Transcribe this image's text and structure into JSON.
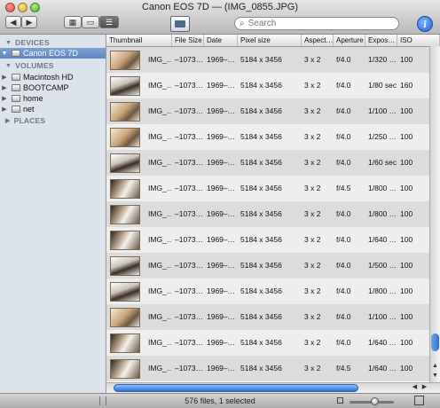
{
  "window": {
    "title": "Canon EOS 7D — (IMG_0855.JPG)"
  },
  "toolbar": {
    "back_glyph": "◀",
    "forward_glyph": "▶",
    "view_grid_glyph": "▦",
    "view_coverflow_glyph": "▭",
    "view_list_glyph": "☰",
    "search": {
      "placeholder": "Search",
      "value": ""
    },
    "info_glyph": "i"
  },
  "sidebar": {
    "devices_label": "DEVICES",
    "device_item": "Canon EOS 7D",
    "volumes_label": "VOLUMES",
    "volumes": [
      "Macintosh HD",
      "BOOTCAMP",
      "home",
      "net"
    ],
    "places_label": "PLACES"
  },
  "table": {
    "columns": [
      "Thumbnail",
      "File Size",
      "Date",
      "Pixel size",
      "Aspect…",
      "Aperture",
      "Expos…",
      "ISO"
    ],
    "rows": [
      {
        "name": "IMG_…",
        "size": "–1073…",
        "date": "1969–…",
        "pixels": "5184 x 3456",
        "aspect": "3 x 2",
        "aperture": "f/4.0",
        "exposure": "1/320 …",
        "iso": "100",
        "thumb": "a"
      },
      {
        "name": "IMG_…",
        "size": "–1073…",
        "date": "1969–…",
        "pixels": "5184 x 3456",
        "aspect": "3 x 2",
        "aperture": "f/4.0",
        "exposure": "1/80 sec",
        "iso": "160",
        "thumb": "b"
      },
      {
        "name": "IMG_…",
        "size": "–1073…",
        "date": "1969–…",
        "pixels": "5184 x 3456",
        "aspect": "3 x 2",
        "aperture": "f/4.0",
        "exposure": "1/100 …",
        "iso": "100",
        "thumb": "a"
      },
      {
        "name": "IMG_…",
        "size": "–1073…",
        "date": "1969–…",
        "pixels": "5184 x 3456",
        "aspect": "3 x 2",
        "aperture": "f/4.0",
        "exposure": "1/250 …",
        "iso": "100",
        "thumb": "a"
      },
      {
        "name": "IMG_…",
        "size": "–1073…",
        "date": "1969–…",
        "pixels": "5184 x 3456",
        "aspect": "3 x 2",
        "aperture": "f/4.0",
        "exposure": "1/60 sec",
        "iso": "100",
        "thumb": "b"
      },
      {
        "name": "IMG_…",
        "size": "–1073…",
        "date": "1969–…",
        "pixels": "5184 x 3456",
        "aspect": "3 x 2",
        "aperture": "f/4.5",
        "exposure": "1/800 …",
        "iso": "100",
        "thumb": "c"
      },
      {
        "name": "IMG_…",
        "size": "–1073…",
        "date": "1969–…",
        "pixels": "5184 x 3456",
        "aspect": "3 x 2",
        "aperture": "f/4.0",
        "exposure": "1/800 …",
        "iso": "100",
        "thumb": "c"
      },
      {
        "name": "IMG_…",
        "size": "–1073…",
        "date": "1969–…",
        "pixels": "5184 x 3456",
        "aspect": "3 x 2",
        "aperture": "f/4.0",
        "exposure": "1/640 …",
        "iso": "100",
        "thumb": "c"
      },
      {
        "name": "IMG_…",
        "size": "–1073…",
        "date": "1969–…",
        "pixels": "5184 x 3456",
        "aspect": "3 x 2",
        "aperture": "f/4.0",
        "exposure": "1/500 …",
        "iso": "100",
        "thumb": "b"
      },
      {
        "name": "IMG_…",
        "size": "–1073…",
        "date": "1969–…",
        "pixels": "5184 x 3456",
        "aspect": "3 x 2",
        "aperture": "f/4.0",
        "exposure": "1/800 …",
        "iso": "100",
        "thumb": "b"
      },
      {
        "name": "IMG_…",
        "size": "–1073…",
        "date": "1969–…",
        "pixels": "5184 x 3456",
        "aspect": "3 x 2",
        "aperture": "f/4.0",
        "exposure": "1/100 …",
        "iso": "100",
        "thumb": "a"
      },
      {
        "name": "IMG_…",
        "size": "–1073…",
        "date": "1969–…",
        "pixels": "5184 x 3456",
        "aspect": "3 x 2",
        "aperture": "f/4.0",
        "exposure": "1/640 …",
        "iso": "100",
        "thumb": "c"
      },
      {
        "name": "IMG_…",
        "size": "–1073…",
        "date": "1969–…",
        "pixels": "5184 x 3456",
        "aspect": "3 x 2",
        "aperture": "f/4.5",
        "exposure": "1/640 …",
        "iso": "100",
        "thumb": "c"
      }
    ]
  },
  "status": {
    "text": "576 files, 1 selected"
  },
  "colors": {
    "selection": "#6f93cc",
    "accent": "#2e6fd1",
    "sidebar_bg": "#dde3ea"
  }
}
